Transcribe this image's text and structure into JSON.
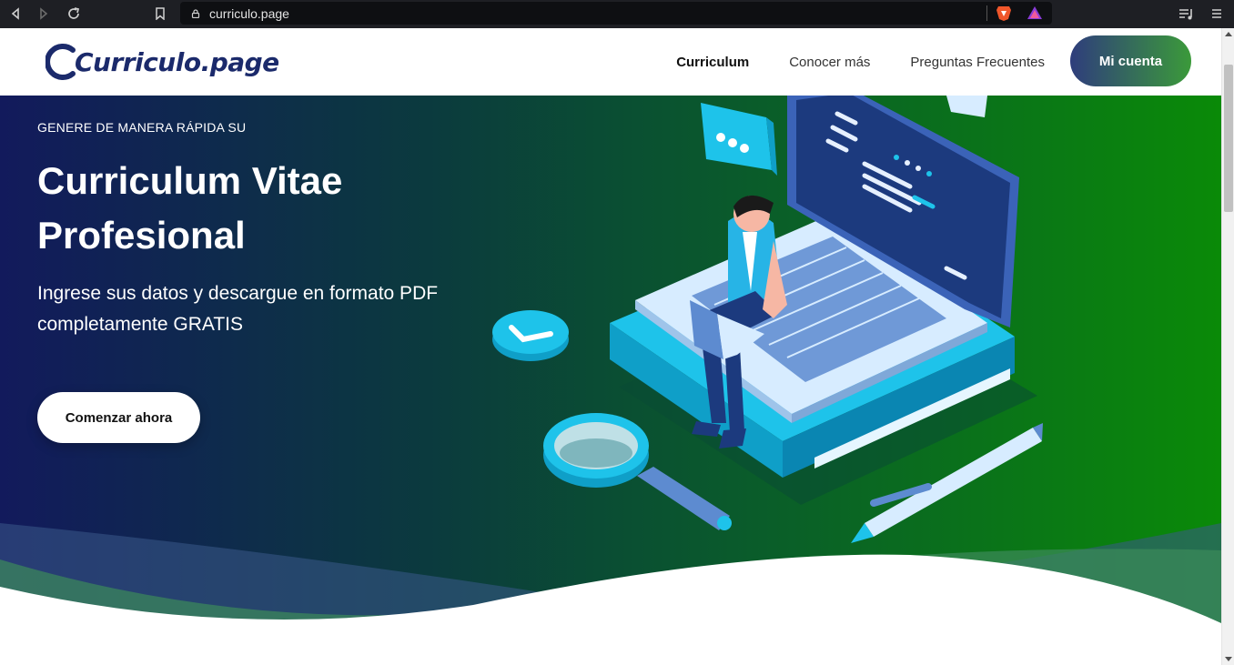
{
  "browser": {
    "url": "curriculo.page"
  },
  "header": {
    "logo_text": "Curriculo.page",
    "nav": [
      {
        "label": "Curriculum",
        "active": true
      },
      {
        "label": "Conocer más",
        "active": false
      },
      {
        "label": "Preguntas Frecuentes",
        "active": false
      }
    ],
    "account_label": "Mi cuenta"
  },
  "hero": {
    "eyebrow": "GENERE DE MANERA RÁPIDA SU",
    "title": "Curriculum Vitae Profesional",
    "subtitle": "Ingrese sus datos y descargue en formato PDF completamente GRATIS",
    "cta_label": "Comenzar ahora"
  },
  "colors": {
    "brand_navy": "#1b2a6b",
    "brand_green": "#0a8a08",
    "accent_cyan": "#1ec3ea"
  }
}
